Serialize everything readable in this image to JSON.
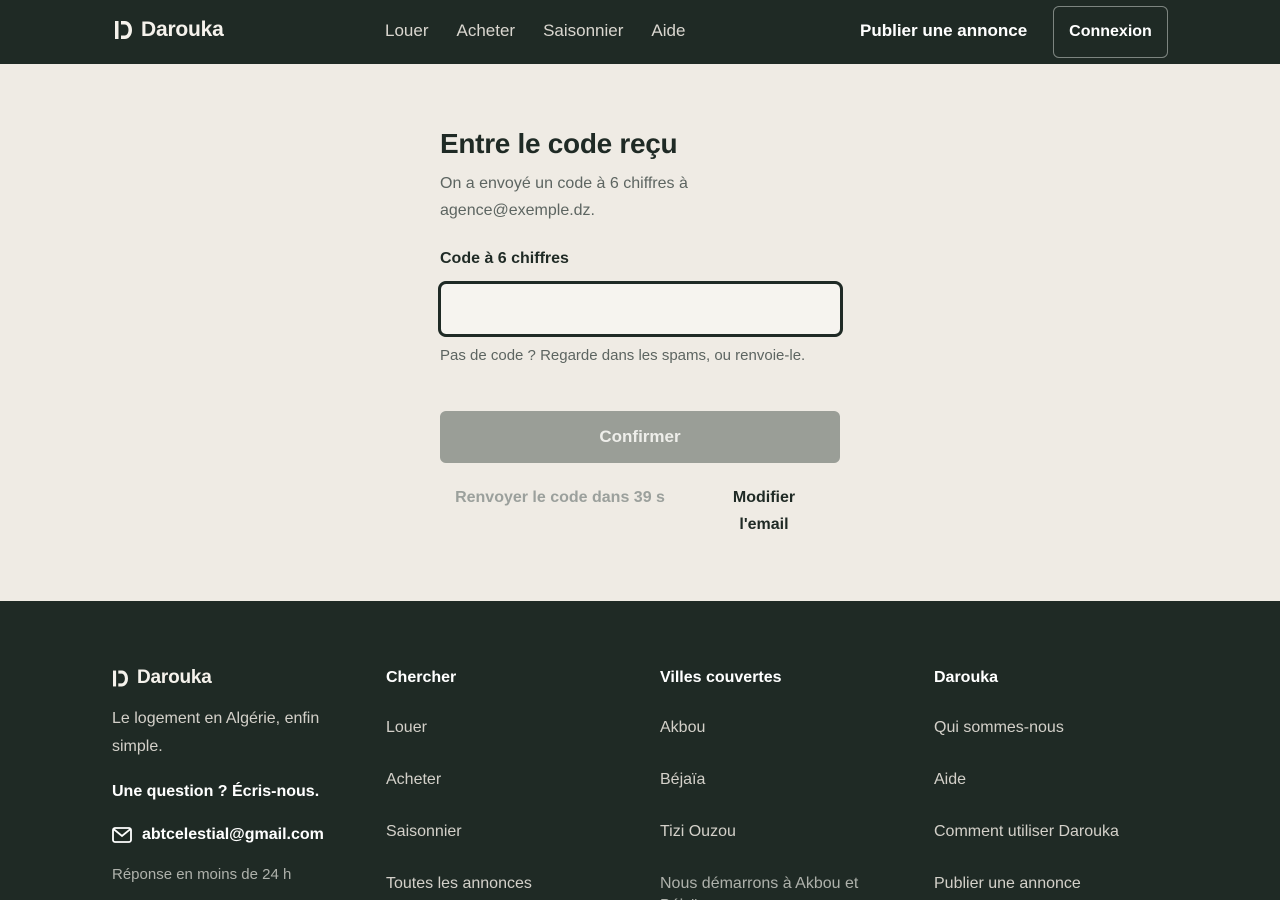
{
  "header": {
    "brand": "Darouka",
    "nav": [
      "Louer",
      "Acheter",
      "Saisonnier",
      "Aide"
    ],
    "publish": "Publier une annonce",
    "login": "Connexion"
  },
  "form": {
    "title": "Entre le code reçu",
    "subtitle": "On a envoyé un code à 6 chiffres à agence@exemple.dz.",
    "field_label": "Code à 6 chiffres",
    "code_value": "",
    "hint": "Pas de code ? Regarde dans les spams, ou renvoie-le.",
    "confirm": "Confirmer",
    "resend": "Renvoyer le code dans 39 s",
    "modify_email": "Modifier l'email"
  },
  "footer": {
    "brand": "Darouka",
    "tagline": "Le logement en Algérie, enfin simple.",
    "question": "Une question ? Écris-nous.",
    "email": "abtcelestial@gmail.com",
    "response": "Réponse en moins de 24 h",
    "columns": [
      {
        "title": "Chercher",
        "links": [
          "Louer",
          "Acheter",
          "Saisonnier",
          "Toutes les annonces"
        ]
      },
      {
        "title": "Villes couvertes",
        "links": [
          "Akbou",
          "Béjaïa",
          "Tizi Ouzou"
        ],
        "note": "Nous démarrons à Akbou et Béjaïa"
      },
      {
        "title": "Darouka",
        "links": [
          "Qui sommes-nous",
          "Aide",
          "Comment utiliser Darouka",
          "Publier une annonce"
        ]
      }
    ]
  },
  "colors": {
    "dark": "#1f2a25",
    "page_bg": "#efebe4",
    "button_disabled": "#9a9e97"
  }
}
